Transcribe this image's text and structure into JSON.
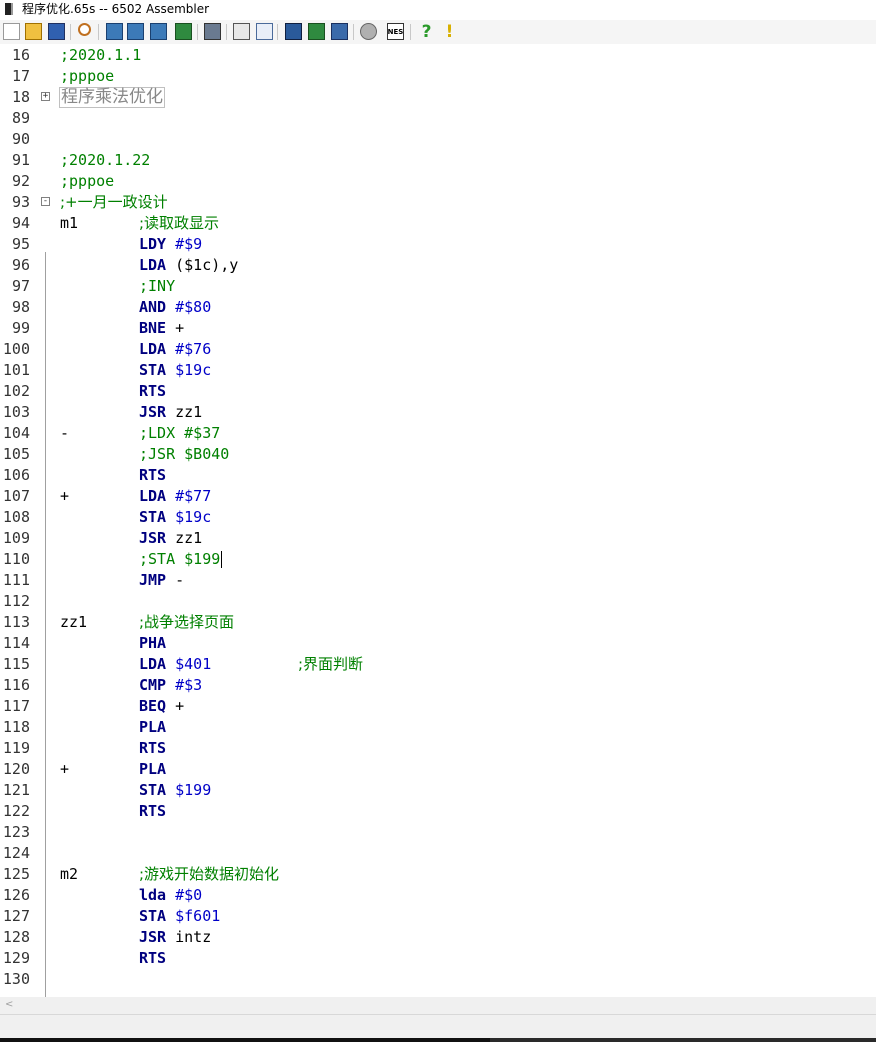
{
  "window": {
    "title": "程序优化.65s -- 6502 Assembler"
  },
  "toolbar": {
    "buttons": [
      {
        "name": "new-file-icon"
      },
      {
        "name": "open-file-icon"
      },
      {
        "name": "save-file-icon"
      },
      {
        "name": "search-icon"
      },
      {
        "name": "assemble-icon"
      },
      {
        "name": "assemble-all-icon"
      },
      {
        "name": "refresh-icon"
      },
      {
        "name": "download-icon"
      },
      {
        "name": "print-icon"
      },
      {
        "name": "calculator-icon"
      },
      {
        "name": "window-icon"
      },
      {
        "name": "book-icon"
      },
      {
        "name": "export-icon"
      },
      {
        "name": "notebook-icon"
      },
      {
        "name": "settings-icon"
      },
      {
        "name": "nes-icon",
        "label": "NES"
      },
      {
        "name": "help-icon",
        "label": "?"
      },
      {
        "name": "info-icon",
        "label": "!"
      }
    ]
  },
  "editor": {
    "collapsed_label": "程序乘法优化",
    "lines": [
      {
        "num": "16",
        "comment": ";2020.1.1"
      },
      {
        "num": "17",
        "comment": ";pppoe"
      },
      {
        "num": "18",
        "fold": "+",
        "collapsed": true
      },
      {
        "num": "89"
      },
      {
        "num": "90"
      },
      {
        "num": "91",
        "comment": ";2020.1.22"
      },
      {
        "num": "92",
        "comment": ";pppoe"
      },
      {
        "num": "93",
        "fold": "-",
        "comment": ";+一月一政设计"
      },
      {
        "num": "94",
        "label": "m1",
        "comment": ";读取政显示"
      },
      {
        "num": "95",
        "op": "LDY",
        "arg": "#$9"
      },
      {
        "num": "96",
        "op": "LDA",
        "plain": "($1c),y"
      },
      {
        "num": "97",
        "comment": ";INY"
      },
      {
        "num": "98",
        "op": "AND",
        "arg": "#$80"
      },
      {
        "num": "99",
        "op": "BNE",
        "plain": "+"
      },
      {
        "num": "100",
        "op": "LDA",
        "arg": "#$76"
      },
      {
        "num": "101",
        "op": "STA",
        "arg": "$19c"
      },
      {
        "num": "102",
        "op": "RTS"
      },
      {
        "num": "103",
        "op": "JSR",
        "plain": "zz1"
      },
      {
        "num": "104",
        "label": "-",
        "comment": ";LDX #$37"
      },
      {
        "num": "105",
        "comment": ";JSR $B040"
      },
      {
        "num": "106",
        "op": "RTS"
      },
      {
        "num": "107",
        "label": "+",
        "op": "LDA",
        "arg": "#$77"
      },
      {
        "num": "108",
        "op": "STA",
        "arg": "$19c"
      },
      {
        "num": "109",
        "op": "JSR",
        "plain": "zz1"
      },
      {
        "num": "110",
        "comment": ";STA $199",
        "cursor": true
      },
      {
        "num": "111",
        "op": "JMP",
        "plain": "-"
      },
      {
        "num": "112"
      },
      {
        "num": "113",
        "label": "zz1",
        "comment": ";战争选择页面"
      },
      {
        "num": "114",
        "op": "PHA"
      },
      {
        "num": "115",
        "op": "LDA",
        "arg": "$401",
        "trailing": ";界面判断"
      },
      {
        "num": "116",
        "op": "CMP",
        "arg": "#$3"
      },
      {
        "num": "117",
        "op": "BEQ",
        "plain": "+"
      },
      {
        "num": "118",
        "op": "PLA"
      },
      {
        "num": "119",
        "op": "RTS"
      },
      {
        "num": "120",
        "label": "+",
        "op": "PLA"
      },
      {
        "num": "121",
        "op": "STA",
        "arg": "$199"
      },
      {
        "num": "122",
        "op": "RTS"
      },
      {
        "num": "123"
      },
      {
        "num": "124"
      },
      {
        "num": "125",
        "label": "m2",
        "comment": ";游戏开始数据初始化"
      },
      {
        "num": "126",
        "op": "lda",
        "arg": "#$0"
      },
      {
        "num": "127",
        "op": "STA",
        "arg": "$f601"
      },
      {
        "num": "128",
        "op": "JSR",
        "plain": "intz"
      },
      {
        "num": "129",
        "op": "RTS"
      },
      {
        "num": "130"
      }
    ]
  },
  "scrollbar": {
    "left_arrow": "<"
  },
  "colors": {
    "comment": "#008000",
    "opcode": "#00007f",
    "operand": "#0000c8"
  }
}
